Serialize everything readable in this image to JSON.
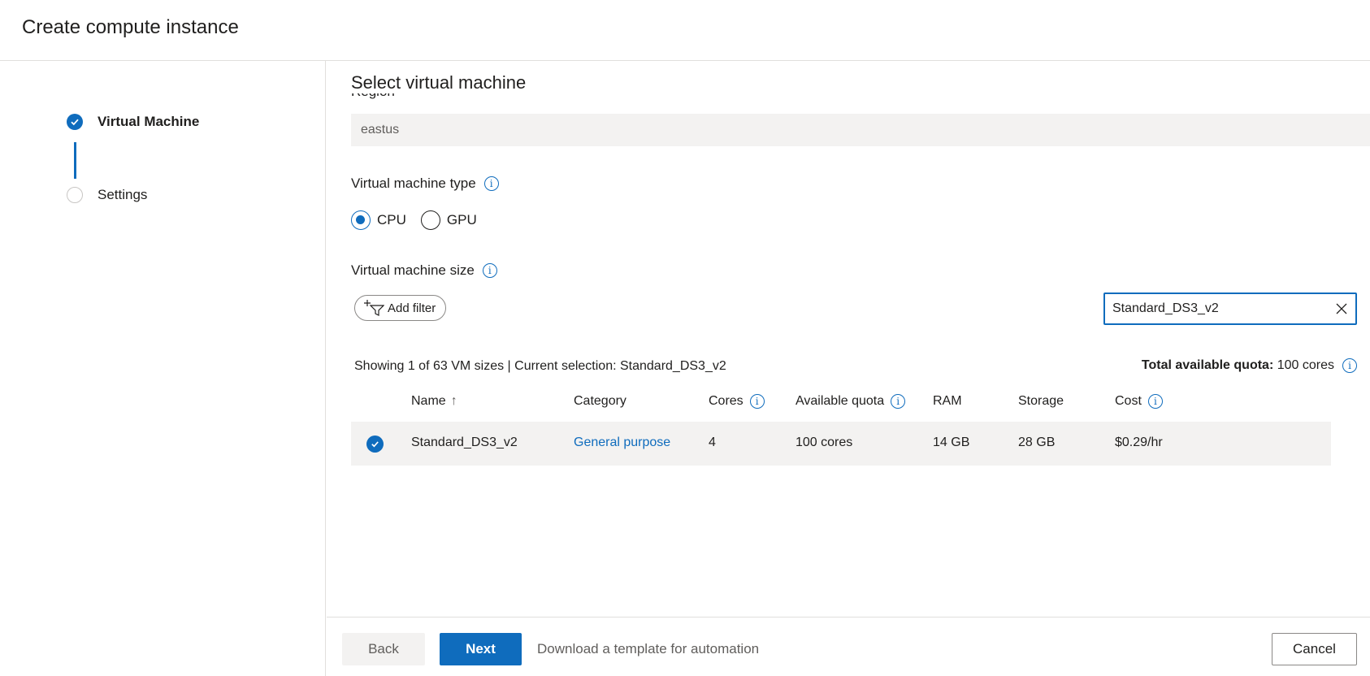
{
  "header": {
    "title": "Create compute instance"
  },
  "steps": [
    {
      "label": "Virtual Machine",
      "state": "completed"
    },
    {
      "label": "Settings",
      "state": "pending"
    }
  ],
  "main": {
    "section_title": "Select virtual machine",
    "region": {
      "label": "Region",
      "value": "eastus"
    },
    "vm_type": {
      "label": "Virtual machine type",
      "options": [
        "CPU",
        "GPU"
      ],
      "selected": "CPU"
    },
    "vm_size": {
      "label": "Virtual machine size",
      "add_filter_label": "Add filter",
      "search_value": "Standard_DS3_v2"
    },
    "summary": "Showing 1 of 63 VM sizes | Current selection: Standard_DS3_v2",
    "quota": {
      "label": "Total available quota:",
      "value": "100 cores"
    },
    "table": {
      "columns": [
        "Name",
        "Category",
        "Cores",
        "Available quota",
        "RAM",
        "Storage",
        "Cost"
      ],
      "sort_indicator": "↑",
      "rows": [
        {
          "selected": true,
          "name": "Standard_DS3_v2",
          "category": "General purpose",
          "cores": "4",
          "available_quota": "100 cores",
          "ram": "14 GB",
          "storage": "28 GB",
          "cost": "$0.29/hr"
        }
      ]
    }
  },
  "footer": {
    "back_label": "Back",
    "next_label": "Next",
    "download_label": "Download a template for automation",
    "cancel_label": "Cancel"
  },
  "colors": {
    "accent": "#0f6cbd",
    "row_background": "#f3f2f1"
  }
}
